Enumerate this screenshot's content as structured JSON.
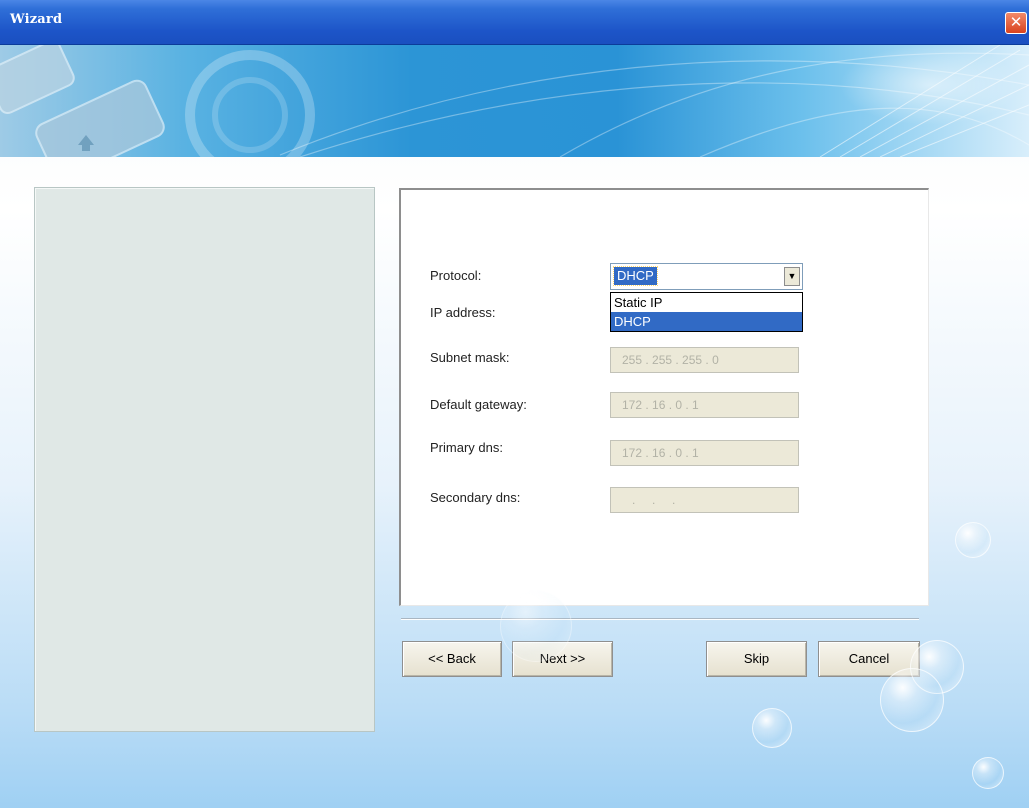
{
  "window": {
    "title": "Wizard"
  },
  "form": {
    "protocol_label": "Protocol:",
    "protocol_value": "DHCP",
    "protocol_options": [
      "Static IP",
      "DHCP"
    ],
    "ip_address_label": "IP address:",
    "subnet_mask_label": "Subnet mask:",
    "subnet_mask_value": "255 . 255 . 255 . 0",
    "default_gateway_label": "Default gateway:",
    "default_gateway_value": "172 . 16 . 0 . 1",
    "primary_dns_label": "Primary dns:",
    "primary_dns_value": "172 . 16 . 0 . 1",
    "secondary_dns_label": "Secondary dns:",
    "secondary_dns_value": "   .     .     ."
  },
  "buttons": {
    "back": "<< Back",
    "next": "Next >>",
    "skip": "Skip",
    "cancel": "Cancel"
  },
  "icons": {
    "close": "close-icon",
    "dropdown_arrow": "chevron-down-icon"
  },
  "colors": {
    "titlebar": "#1d55c8",
    "selection": "#316ac5",
    "disabled_field": "#ece9d8",
    "close_button": "#d9431e"
  }
}
